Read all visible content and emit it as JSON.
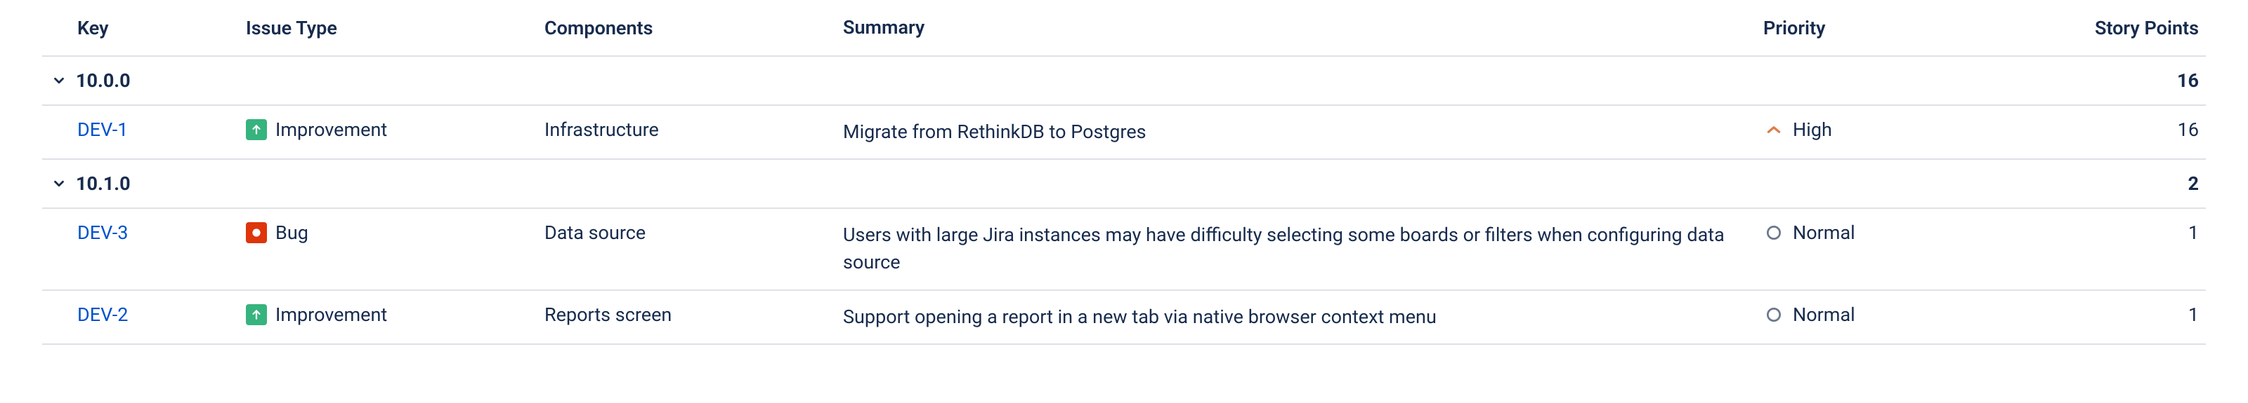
{
  "columns": {
    "key": "Key",
    "issueType": "Issue Type",
    "components": "Components",
    "summary": "Summary",
    "priority": "Priority",
    "storyPoints": "Story Points"
  },
  "groups": [
    {
      "version": "10.0.0",
      "storyPoints": "16",
      "rows": [
        {
          "key": "DEV-1",
          "issueType": "Improvement",
          "issueTypeKind": "improvement",
          "components": "Infrastructure",
          "summary": "Migrate from RethinkDB to Postgres",
          "priority": "High",
          "priorityKind": "high",
          "storyPoints": "16"
        }
      ]
    },
    {
      "version": "10.1.0",
      "storyPoints": "2",
      "rows": [
        {
          "key": "DEV-3",
          "issueType": "Bug",
          "issueTypeKind": "bug",
          "components": "Data source",
          "summary": "Users with large Jira instances may have difficulty selecting some boards or filters when configuring data source",
          "priority": "Normal",
          "priorityKind": "normal",
          "storyPoints": "1"
        },
        {
          "key": "DEV-2",
          "issueType": "Improvement",
          "issueTypeKind": "improvement",
          "components": "Reports screen",
          "summary": "Support opening a report in a new tab via native browser context menu",
          "priority": "Normal",
          "priorityKind": "normal",
          "storyPoints": "1"
        }
      ]
    }
  ]
}
